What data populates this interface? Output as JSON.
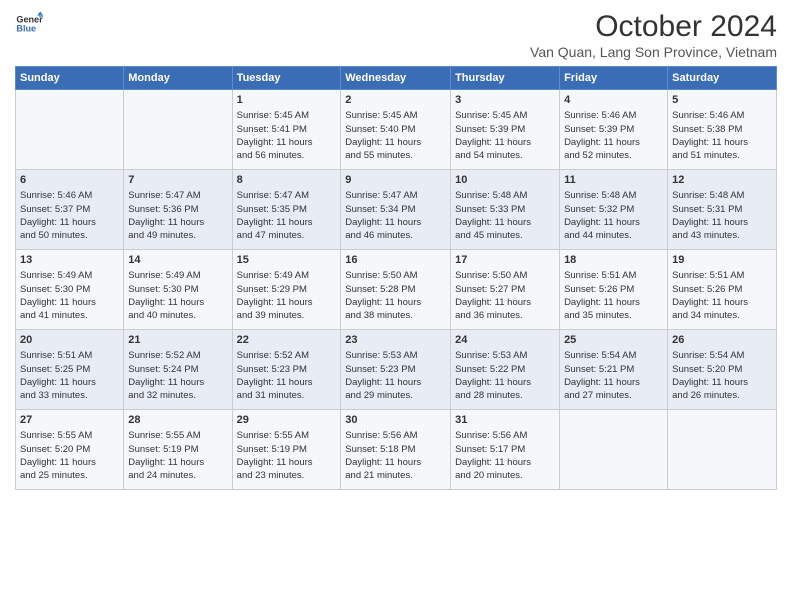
{
  "header": {
    "logo_line1": "General",
    "logo_line2": "Blue",
    "month": "October 2024",
    "location": "Van Quan, Lang Son Province, Vietnam"
  },
  "days_of_week": [
    "Sunday",
    "Monday",
    "Tuesday",
    "Wednesday",
    "Thursday",
    "Friday",
    "Saturday"
  ],
  "weeks": [
    [
      {
        "day": "",
        "text": ""
      },
      {
        "day": "",
        "text": ""
      },
      {
        "day": "1",
        "text": "Sunrise: 5:45 AM\nSunset: 5:41 PM\nDaylight: 11 hours\nand 56 minutes."
      },
      {
        "day": "2",
        "text": "Sunrise: 5:45 AM\nSunset: 5:40 PM\nDaylight: 11 hours\nand 55 minutes."
      },
      {
        "day": "3",
        "text": "Sunrise: 5:45 AM\nSunset: 5:39 PM\nDaylight: 11 hours\nand 54 minutes."
      },
      {
        "day": "4",
        "text": "Sunrise: 5:46 AM\nSunset: 5:39 PM\nDaylight: 11 hours\nand 52 minutes."
      },
      {
        "day": "5",
        "text": "Sunrise: 5:46 AM\nSunset: 5:38 PM\nDaylight: 11 hours\nand 51 minutes."
      }
    ],
    [
      {
        "day": "6",
        "text": "Sunrise: 5:46 AM\nSunset: 5:37 PM\nDaylight: 11 hours\nand 50 minutes."
      },
      {
        "day": "7",
        "text": "Sunrise: 5:47 AM\nSunset: 5:36 PM\nDaylight: 11 hours\nand 49 minutes."
      },
      {
        "day": "8",
        "text": "Sunrise: 5:47 AM\nSunset: 5:35 PM\nDaylight: 11 hours\nand 47 minutes."
      },
      {
        "day": "9",
        "text": "Sunrise: 5:47 AM\nSunset: 5:34 PM\nDaylight: 11 hours\nand 46 minutes."
      },
      {
        "day": "10",
        "text": "Sunrise: 5:48 AM\nSunset: 5:33 PM\nDaylight: 11 hours\nand 45 minutes."
      },
      {
        "day": "11",
        "text": "Sunrise: 5:48 AM\nSunset: 5:32 PM\nDaylight: 11 hours\nand 44 minutes."
      },
      {
        "day": "12",
        "text": "Sunrise: 5:48 AM\nSunset: 5:31 PM\nDaylight: 11 hours\nand 43 minutes."
      }
    ],
    [
      {
        "day": "13",
        "text": "Sunrise: 5:49 AM\nSunset: 5:30 PM\nDaylight: 11 hours\nand 41 minutes."
      },
      {
        "day": "14",
        "text": "Sunrise: 5:49 AM\nSunset: 5:30 PM\nDaylight: 11 hours\nand 40 minutes."
      },
      {
        "day": "15",
        "text": "Sunrise: 5:49 AM\nSunset: 5:29 PM\nDaylight: 11 hours\nand 39 minutes."
      },
      {
        "day": "16",
        "text": "Sunrise: 5:50 AM\nSunset: 5:28 PM\nDaylight: 11 hours\nand 38 minutes."
      },
      {
        "day": "17",
        "text": "Sunrise: 5:50 AM\nSunset: 5:27 PM\nDaylight: 11 hours\nand 36 minutes."
      },
      {
        "day": "18",
        "text": "Sunrise: 5:51 AM\nSunset: 5:26 PM\nDaylight: 11 hours\nand 35 minutes."
      },
      {
        "day": "19",
        "text": "Sunrise: 5:51 AM\nSunset: 5:26 PM\nDaylight: 11 hours\nand 34 minutes."
      }
    ],
    [
      {
        "day": "20",
        "text": "Sunrise: 5:51 AM\nSunset: 5:25 PM\nDaylight: 11 hours\nand 33 minutes."
      },
      {
        "day": "21",
        "text": "Sunrise: 5:52 AM\nSunset: 5:24 PM\nDaylight: 11 hours\nand 32 minutes."
      },
      {
        "day": "22",
        "text": "Sunrise: 5:52 AM\nSunset: 5:23 PM\nDaylight: 11 hours\nand 31 minutes."
      },
      {
        "day": "23",
        "text": "Sunrise: 5:53 AM\nSunset: 5:23 PM\nDaylight: 11 hours\nand 29 minutes."
      },
      {
        "day": "24",
        "text": "Sunrise: 5:53 AM\nSunset: 5:22 PM\nDaylight: 11 hours\nand 28 minutes."
      },
      {
        "day": "25",
        "text": "Sunrise: 5:54 AM\nSunset: 5:21 PM\nDaylight: 11 hours\nand 27 minutes."
      },
      {
        "day": "26",
        "text": "Sunrise: 5:54 AM\nSunset: 5:20 PM\nDaylight: 11 hours\nand 26 minutes."
      }
    ],
    [
      {
        "day": "27",
        "text": "Sunrise: 5:55 AM\nSunset: 5:20 PM\nDaylight: 11 hours\nand 25 minutes."
      },
      {
        "day": "28",
        "text": "Sunrise: 5:55 AM\nSunset: 5:19 PM\nDaylight: 11 hours\nand 24 minutes."
      },
      {
        "day": "29",
        "text": "Sunrise: 5:55 AM\nSunset: 5:19 PM\nDaylight: 11 hours\nand 23 minutes."
      },
      {
        "day": "30",
        "text": "Sunrise: 5:56 AM\nSunset: 5:18 PM\nDaylight: 11 hours\nand 21 minutes."
      },
      {
        "day": "31",
        "text": "Sunrise: 5:56 AM\nSunset: 5:17 PM\nDaylight: 11 hours\nand 20 minutes."
      },
      {
        "day": "",
        "text": ""
      },
      {
        "day": "",
        "text": ""
      }
    ]
  ]
}
